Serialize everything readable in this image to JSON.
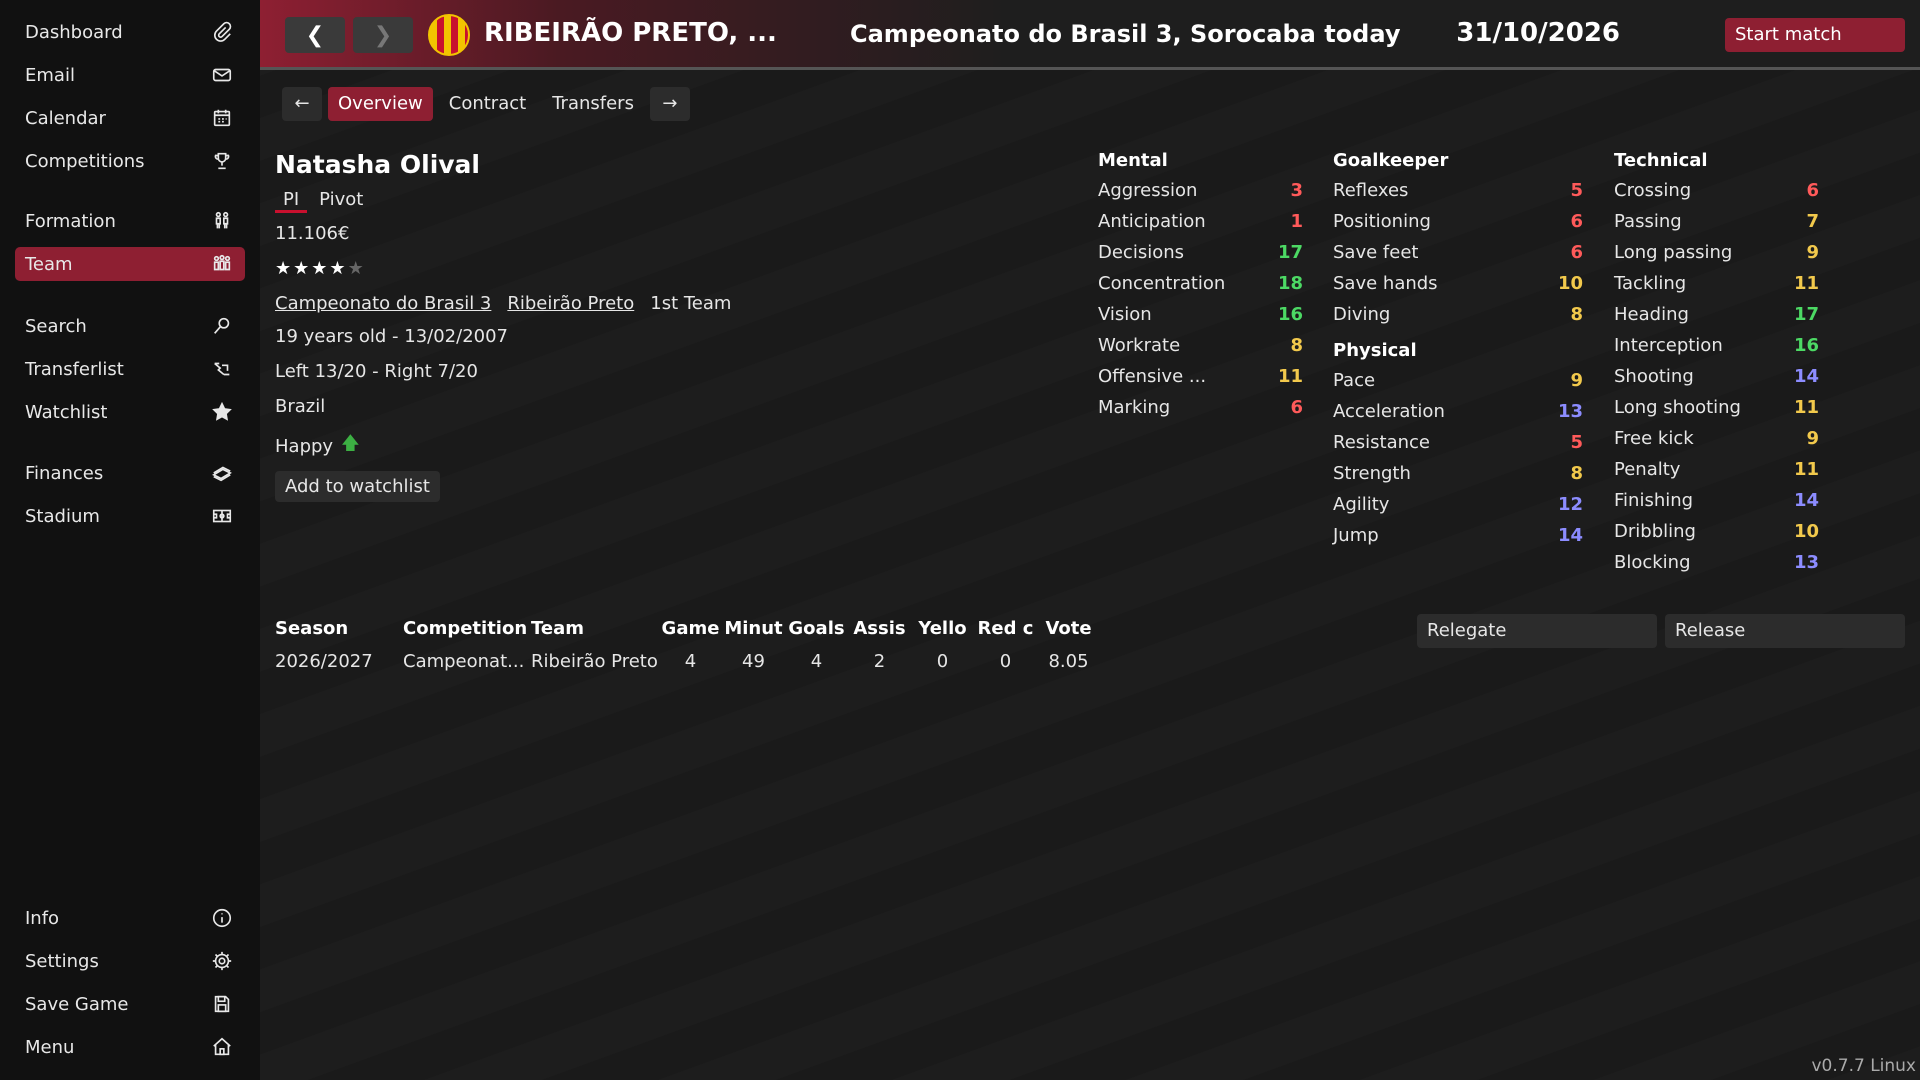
{
  "sidebar": {
    "top": [
      {
        "label": "Dashboard",
        "icon": "paperclip-icon"
      },
      {
        "label": "Email",
        "icon": "envelope-icon"
      },
      {
        "label": "Calendar",
        "icon": "calendar-icon"
      },
      {
        "label": "Competitions",
        "icon": "trophy-icon"
      }
    ],
    "mid1": [
      {
        "label": "Formation",
        "icon": "formation-icon"
      },
      {
        "label": "Team",
        "icon": "team-icon"
      }
    ],
    "mid2": [
      {
        "label": "Search",
        "icon": "search-icon"
      },
      {
        "label": "Transferlist",
        "icon": "transfer-icon"
      },
      {
        "label": "Watchlist",
        "icon": "star-icon"
      }
    ],
    "mid3": [
      {
        "label": "Finances",
        "icon": "money-icon"
      },
      {
        "label": "Stadium",
        "icon": "stadium-icon"
      }
    ],
    "bottom": [
      {
        "label": "Info",
        "icon": "info-icon"
      },
      {
        "label": "Settings",
        "icon": "gear-icon"
      },
      {
        "label": "Save Game",
        "icon": "save-icon"
      },
      {
        "label": "Menu",
        "icon": "home-icon"
      }
    ],
    "active": "Team"
  },
  "header": {
    "back": "❮",
    "forward": "❯",
    "club_name": "RIBEIRÃO PRETO, ...",
    "title": "Campeonato do Brasil 3, Sorocaba today",
    "date": "31/10/2026",
    "start_match": "Start match",
    "colors": {
      "accent": "#8e1f32",
      "badge_yellow": "#f2c400",
      "badge_red": "#c8102e"
    }
  },
  "tabs": {
    "prev": "←",
    "next": "→",
    "items": [
      "Overview",
      "Contract",
      "Transfers"
    ],
    "active": "Overview"
  },
  "player": {
    "name": "Natasha Olival",
    "position_abbr": "PI",
    "position": "Pivot",
    "value": "11.106€",
    "stars": 4,
    "stars_max": 5,
    "competition": "Campeonato do Brasil 3",
    "club": "Ribeirão Preto",
    "squad": "1st Team",
    "age_line": "19 years old - 13/02/2007",
    "feet": "Left 13/20 - Right 7/20",
    "nationality": "Brazil",
    "mood": "Happy",
    "watchlist_button": "Add to watchlist"
  },
  "attributes": {
    "mental": {
      "title": "Mental",
      "rows": [
        {
          "name": "Aggression",
          "value": "3"
        },
        {
          "name": "Anticipation",
          "value": "1"
        },
        {
          "name": "Decisions",
          "value": "17"
        },
        {
          "name": "Concentration",
          "value": "18"
        },
        {
          "name": "Vision",
          "value": "16"
        },
        {
          "name": "Workrate",
          "value": "8"
        },
        {
          "name": "Offensive ...",
          "value": "11"
        },
        {
          "name": "Marking",
          "value": "6"
        }
      ]
    },
    "goalkeeper": {
      "title": "Goalkeeper",
      "rows": [
        {
          "name": "Reflexes",
          "value": "5"
        },
        {
          "name": "Positioning",
          "value": "6"
        },
        {
          "name": "Save feet",
          "value": "6"
        },
        {
          "name": "Save hands",
          "value": "10"
        },
        {
          "name": "Diving",
          "value": "8"
        }
      ]
    },
    "physical": {
      "title": "Physical",
      "rows": [
        {
          "name": "Pace",
          "value": "9"
        },
        {
          "name": "Acceleration",
          "value": "13"
        },
        {
          "name": "Resistance",
          "value": "5"
        },
        {
          "name": "Strength",
          "value": "8"
        },
        {
          "name": "Agility",
          "value": "12"
        },
        {
          "name": "Jump",
          "value": "14"
        }
      ]
    },
    "technical": {
      "title": "Technical",
      "rows": [
        {
          "name": "Crossing",
          "value": "6"
        },
        {
          "name": "Passing",
          "value": "7"
        },
        {
          "name": "Long passing",
          "value": "9"
        },
        {
          "name": "Tackling",
          "value": "11"
        },
        {
          "name": "Heading",
          "value": "17"
        },
        {
          "name": "Interception",
          "value": "16"
        },
        {
          "name": "Shooting",
          "value": "14"
        },
        {
          "name": "Long shooting",
          "value": "11"
        },
        {
          "name": "Free kick",
          "value": "9"
        },
        {
          "name": "Penalty",
          "value": "11"
        },
        {
          "name": "Finishing",
          "value": "14"
        },
        {
          "name": "Dribbling",
          "value": "10"
        },
        {
          "name": "Blocking",
          "value": "13"
        }
      ]
    },
    "value_colors": {
      "low": "#ff5a5a",
      "mid": "#f2c94c",
      "good": "#8c8cff",
      "high": "#4cd964"
    }
  },
  "stats": {
    "headers": [
      "Season",
      "Competition",
      "Team",
      "Game",
      "Minut",
      "Goals",
      "Assis",
      "Yello",
      "Red c",
      "Vote"
    ],
    "rows": [
      [
        "2026/2027",
        "Campeonat...",
        "Ribeirão Preto",
        "4",
        "49",
        "4",
        "2",
        "0",
        "0",
        "8.05"
      ]
    ]
  },
  "actions": {
    "relegate": "Relegate",
    "release": "Release"
  },
  "version": "v0.7.7 Linux"
}
